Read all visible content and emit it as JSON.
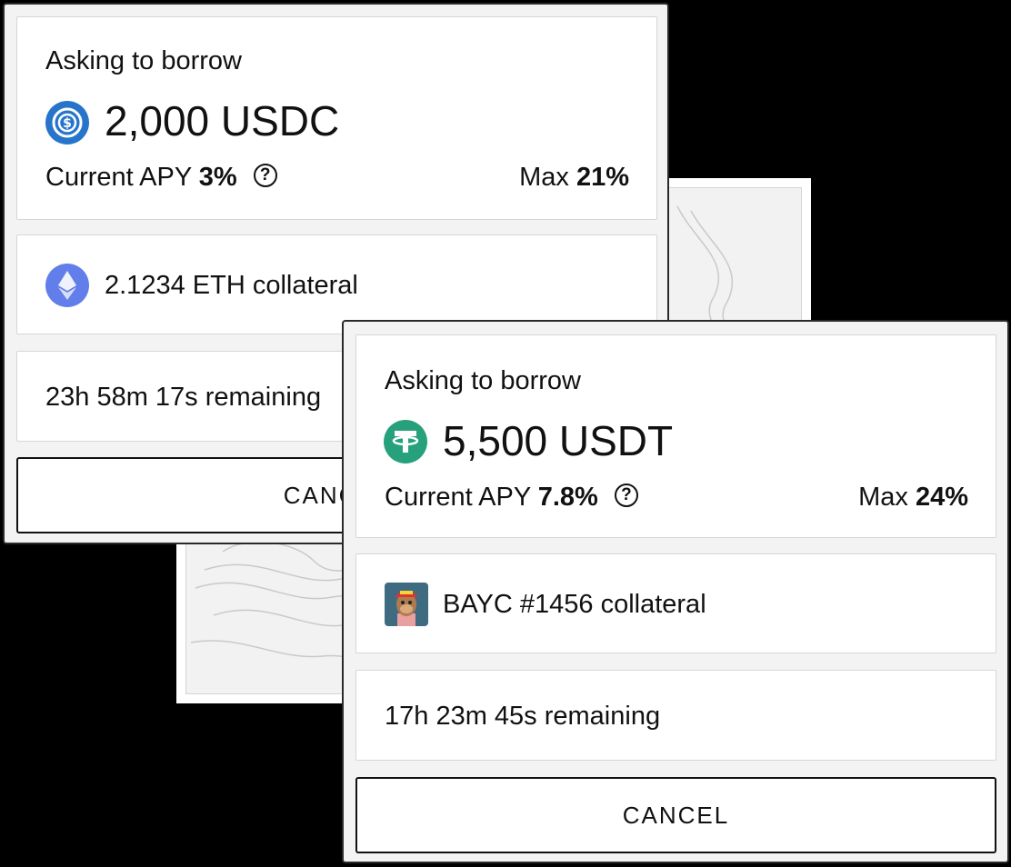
{
  "card1": {
    "heading": "Asking to borrow",
    "amount": "2,000 USDC",
    "token_icon": "usdc-icon",
    "apy_label": "Current APY",
    "apy_value": "3%",
    "help_glyph": "?",
    "max_label": "Max",
    "max_value": "21%",
    "collateral": "2.1234 ETH collateral",
    "collateral_icon": "eth-icon",
    "remaining": "23h 58m 17s remaining",
    "cancel_label": "CANCEL",
    "colors": {
      "usdc": "#2775ca",
      "eth": "#627eea"
    }
  },
  "card2": {
    "heading": "Asking to borrow",
    "amount": "5,500 USDT",
    "token_icon": "usdt-icon",
    "apy_label": "Current APY",
    "apy_value": "7.8%",
    "help_glyph": "?",
    "max_label": "Max",
    "max_value": "24%",
    "collateral": "BAYC #1456 collateral",
    "collateral_icon": "bayc-nft-icon",
    "remaining": "17h 23m 45s remaining",
    "cancel_label": "CANCEL",
    "colors": {
      "usdt": "#26a17b"
    }
  }
}
